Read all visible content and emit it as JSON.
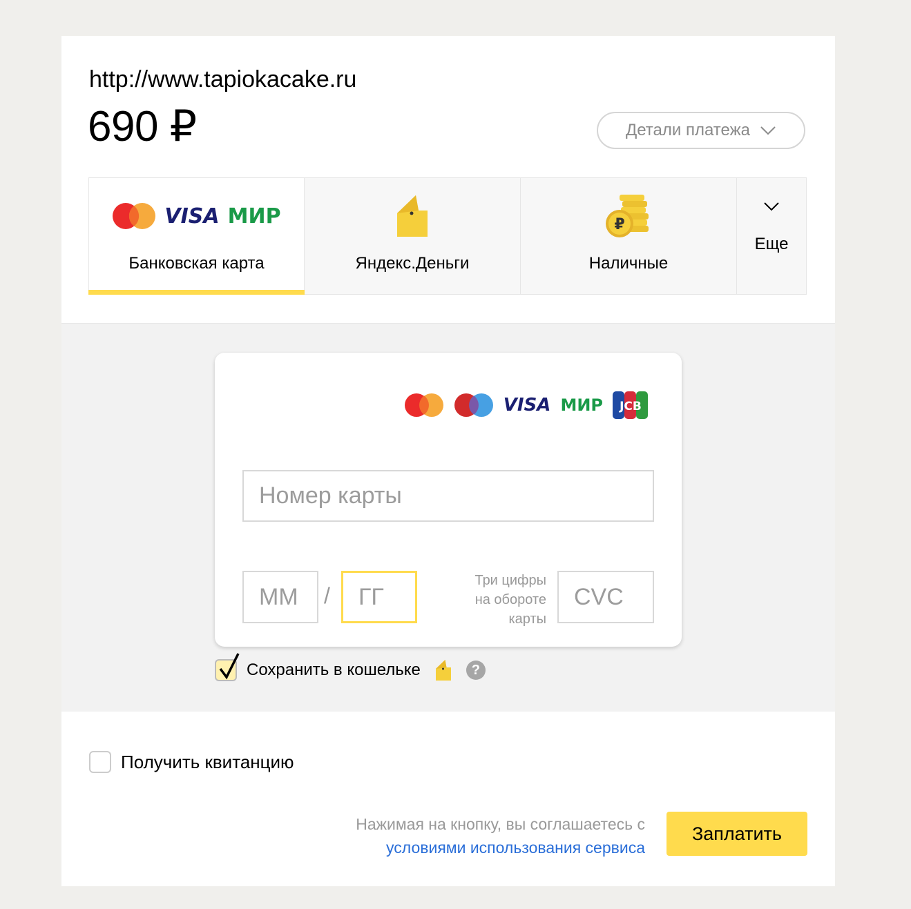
{
  "merchant": {
    "url": "http://www.tapiokacake.ru"
  },
  "payment": {
    "amount": "690 ₽"
  },
  "details_button": {
    "label": "Детали платежа",
    "icon": "chevron-down-icon"
  },
  "tabs": [
    {
      "label": "Банковская карта",
      "active": true,
      "icons": [
        "mastercard-logo",
        "visa-logo",
        "mir-logo"
      ]
    },
    {
      "label": "Яндекс.Деньги",
      "active": false,
      "icons": [
        "yandex-wallet-icon"
      ]
    },
    {
      "label": "Наличные",
      "active": false,
      "icons": [
        "coins-ruble-icon"
      ]
    },
    {
      "label": "Еще",
      "active": false,
      "icons": [
        "chevron-down-icon"
      ]
    }
  ],
  "brand_text": {
    "visa": "VISA",
    "mir": "МИР",
    "jcb": "JCB"
  },
  "card_form": {
    "supported_logos": [
      "mastercard-logo",
      "maestro-logo",
      "visa-logo",
      "mir-logo",
      "jcb-logo"
    ],
    "number_placeholder": "Номер карты",
    "month_placeholder": "ММ",
    "year_placeholder": "ГГ",
    "separator": "/",
    "cvc_placeholder": "CVC",
    "cvc_hint": [
      "Три цифры",
      "на обороте",
      "карты"
    ]
  },
  "save_wallet": {
    "label": "Сохранить в кошельке",
    "checked": true,
    "help": "?"
  },
  "receipt": {
    "label": "Получить квитанцию",
    "checked": false
  },
  "agreement": {
    "text": "Нажимая на кнопку, вы соглашаетесь с",
    "link": "условиями использования сервиса"
  },
  "pay_button": {
    "label": "Заплатить"
  },
  "colors": {
    "accent": "#ffdb4d",
    "link": "#2a6ed8",
    "muted": "#999999"
  }
}
